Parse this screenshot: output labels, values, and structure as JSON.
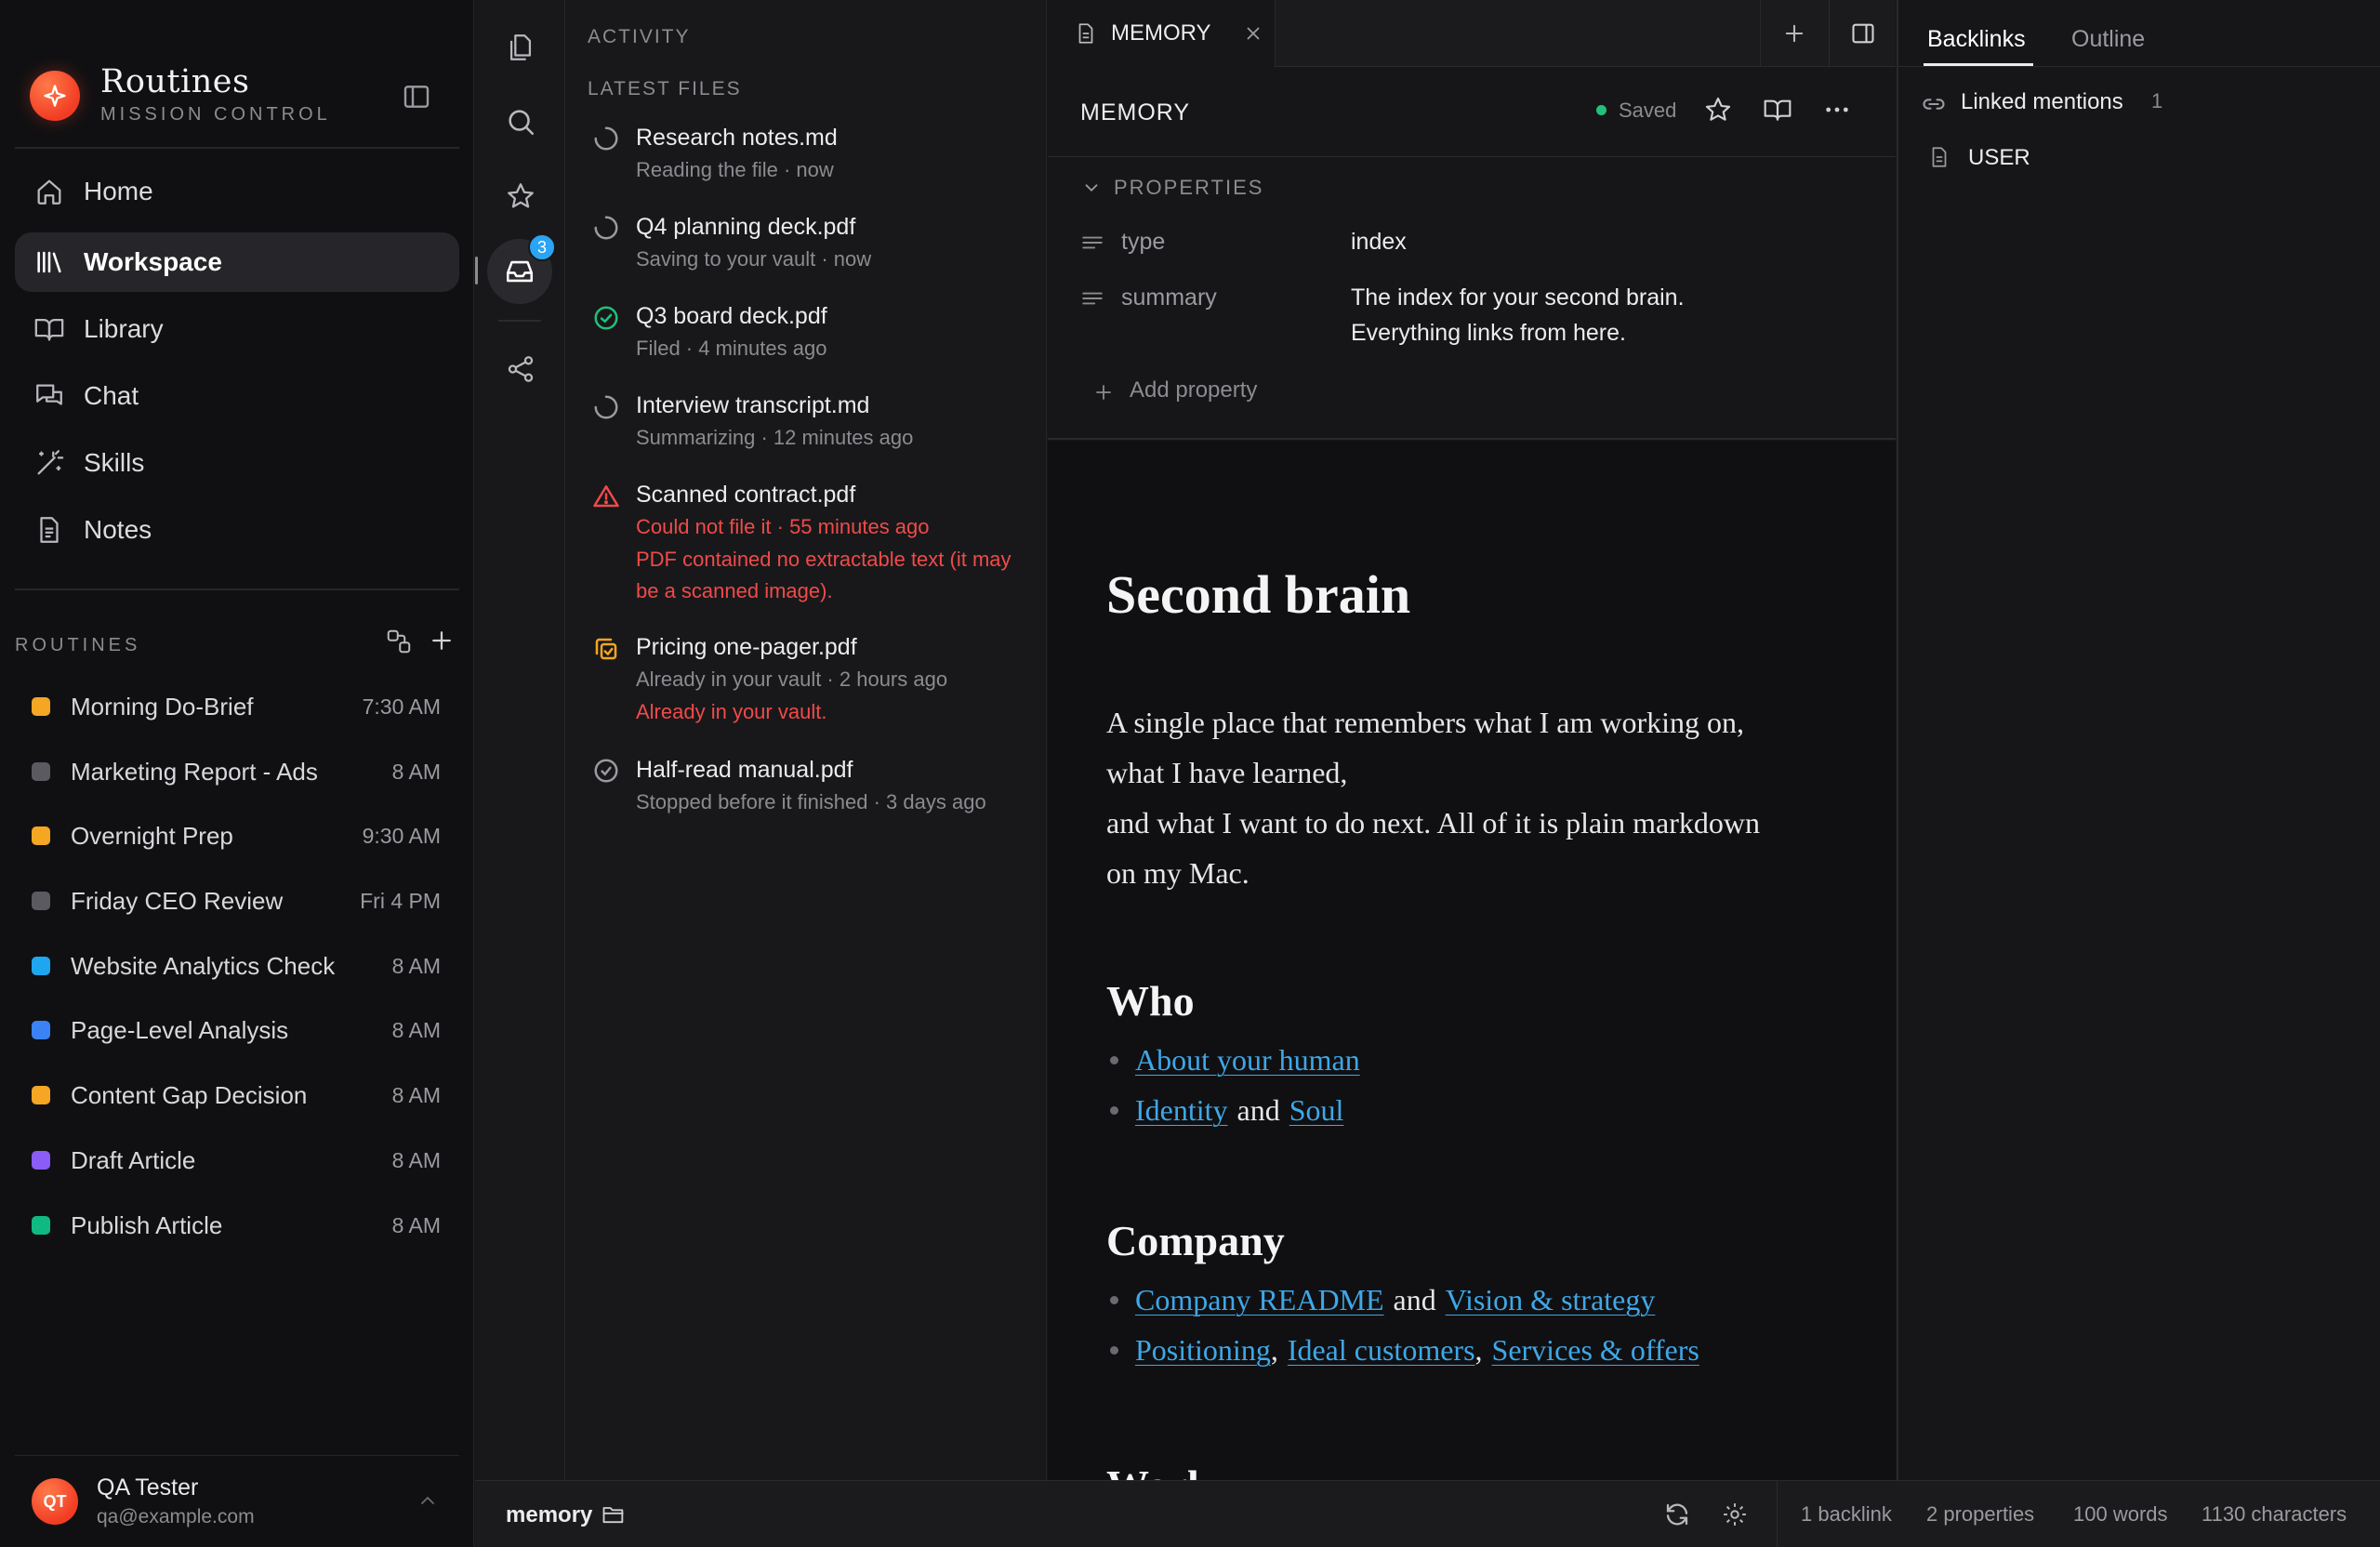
{
  "brand": {
    "title": "Routines",
    "subtitle": "MISSION CONTROL"
  },
  "nav": [
    {
      "label": "Home",
      "icon": "home-icon",
      "active": false
    },
    {
      "label": "Workspace",
      "icon": "library-icon",
      "active": true
    },
    {
      "label": "Library",
      "icon": "book-icon",
      "active": false
    },
    {
      "label": "Chat",
      "icon": "chat-icon",
      "active": false
    },
    {
      "label": "Skills",
      "icon": "wand-icon",
      "active": false
    },
    {
      "label": "Notes",
      "icon": "note-icon",
      "active": false
    }
  ],
  "routines": {
    "heading": "ROUTINES",
    "items": [
      {
        "name": "Morning Do-Brief",
        "time": "7:30 AM",
        "color": "#f5a623"
      },
      {
        "name": "Marketing Report - Ads",
        "time": "8 AM",
        "color": "#5a5a60"
      },
      {
        "name": "Overnight Prep",
        "time": "9:30 AM",
        "color": "#f5a623"
      },
      {
        "name": "Friday CEO Review",
        "time": "Fri 4 PM",
        "color": "#5a5a60"
      },
      {
        "name": "Website Analytics Check",
        "time": "8 AM",
        "color": "#1ea7f0"
      },
      {
        "name": "Page-Level Analysis",
        "time": "8 AM",
        "color": "#3b82f6"
      },
      {
        "name": "Content Gap Decision",
        "time": "8 AM",
        "color": "#f5a623"
      },
      {
        "name": "Draft Article",
        "time": "8 AM",
        "color": "#8b5cf6"
      },
      {
        "name": "Publish Article",
        "time": "8 AM",
        "color": "#10b981"
      }
    ]
  },
  "user": {
    "initials": "QT",
    "name": "QA Tester",
    "email": "qa@example.com"
  },
  "rail": {
    "badge": "3"
  },
  "activity": {
    "title": "ACTIVITY",
    "latest_title": "LATEST FILES",
    "files": [
      {
        "name": "Research notes.md",
        "status": "Reading the file · now",
        "state": "loading"
      },
      {
        "name": "Q4 planning deck.pdf",
        "status": "Saving to your vault · now",
        "state": "loading"
      },
      {
        "name": "Q3 board deck.pdf",
        "status": "Filed · 4 minutes ago",
        "state": "done"
      },
      {
        "name": "Interview transcript.md",
        "status": "Summarizing · 12 minutes ago",
        "state": "loading"
      },
      {
        "name": "Scanned contract.pdf",
        "status": "Could not file it · 55 minutes ago",
        "state": "error",
        "detail": "PDF contained no extractable text (it may be a scanned image)."
      },
      {
        "name": "Pricing one-pager.pdf",
        "status": "Already in your vault · 2 hours ago",
        "state": "duplicate",
        "detail": "Already in your vault."
      },
      {
        "name": "Half-read manual.pdf",
        "status": "Stopped before it finished · 3 days ago",
        "state": "stopped"
      }
    ]
  },
  "tabs": {
    "active": "MEMORY"
  },
  "editor": {
    "title": "MEMORY",
    "saved": "Saved",
    "properties_heading": "PROPERTIES",
    "properties": [
      {
        "key": "type",
        "value": "index"
      },
      {
        "key": "summary",
        "value_lines": [
          "The index for your second brain.",
          "Everything links from here."
        ]
      }
    ],
    "add_property": "Add property"
  },
  "document": {
    "h1": "Second brain",
    "intro": [
      "A single place that remembers what I am working on,",
      "what I have learned,",
      "and what I want to do next. All of it is plain markdown",
      "on my Mac."
    ],
    "sections": {
      "who": {
        "heading": "Who",
        "link_about": "About your human",
        "link_identity": "Identity",
        "and1": "and",
        "link_soul": "Soul"
      },
      "company": {
        "heading": "Company",
        "link_readme": "Company README",
        "and1": "and",
        "link_vision": "Vision & strategy",
        "link_positioning": "Positioning",
        "link_customers": "Ideal customers",
        "link_services": "Services & offers",
        "comma": ","
      },
      "work": {
        "heading": "Work"
      }
    }
  },
  "right_panel": {
    "tab_backlinks": "Backlinks",
    "tab_outline": "Outline",
    "linked_label": "Linked mentions",
    "linked_count": "1",
    "backlinks": [
      "USER"
    ]
  },
  "statusbar": {
    "folder": "memory",
    "backlinks": "1 backlink",
    "properties": "2 properties",
    "words": "100 words",
    "characters": "1130 characters"
  },
  "colors": {
    "accent": "#3fa7e8",
    "brand": "#f23c24",
    "error": "#f04a4a",
    "success": "#22c07a",
    "warning": "#f5a623"
  }
}
